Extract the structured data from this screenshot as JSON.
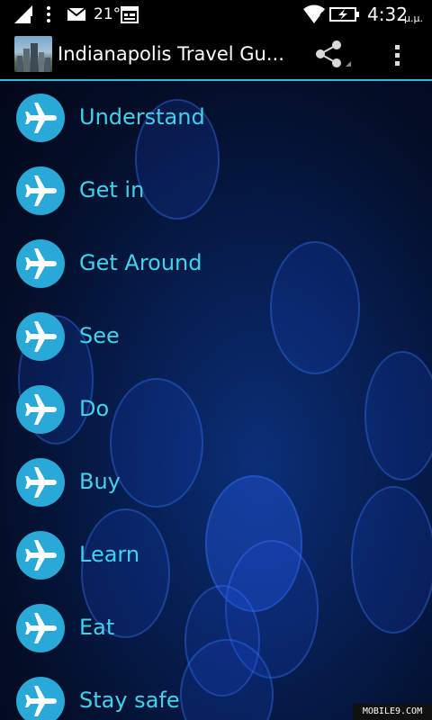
{
  "status_bar": {
    "temperature": "21°",
    "time": "4:32",
    "ampm": "μ.μ.",
    "icons": [
      "signal-icon",
      "more-vert-icon",
      "mail-icon",
      "calendar-icon",
      "wifi-icon",
      "battery-charging-icon"
    ]
  },
  "action_bar": {
    "title": "Indianapolis Travel Gu...",
    "share_icon": "share-icon",
    "overflow_icon": "overflow-menu-icon"
  },
  "menu": {
    "items": [
      {
        "label": "Understand"
      },
      {
        "label": "Get in"
      },
      {
        "label": "Get Around"
      },
      {
        "label": "See"
      },
      {
        "label": "Do"
      },
      {
        "label": "Buy"
      },
      {
        "label": "Learn"
      },
      {
        "label": "Eat"
      },
      {
        "label": "Stay safe"
      }
    ],
    "item_icon": "airplane-icon"
  },
  "colors": {
    "accent": "#33b5e5",
    "item_icon_bg": "#29a9d8",
    "label_color": "#3fd2ee",
    "background": "#061c4c"
  },
  "watermark": "MOBILE9.COM"
}
